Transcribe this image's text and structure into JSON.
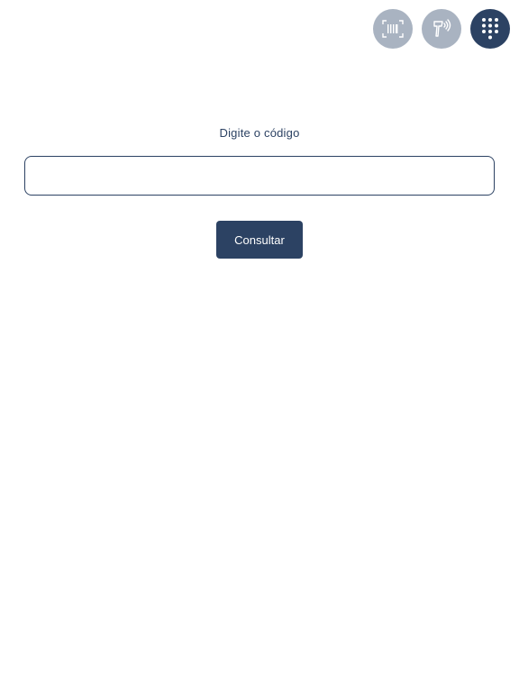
{
  "mode_buttons": [
    {
      "icon": "barcode-scan-icon",
      "state": "inactive"
    },
    {
      "icon": "handheld-scanner-icon",
      "state": "inactive"
    },
    {
      "icon": "keypad-icon",
      "state": "active"
    }
  ],
  "form": {
    "label": "Digite o código",
    "input_value": "",
    "input_placeholder": "",
    "submit_label": "Consultar"
  },
  "colors": {
    "primary": "#2c4263",
    "inactive": "#a9b3c1",
    "background": "#ffffff"
  }
}
